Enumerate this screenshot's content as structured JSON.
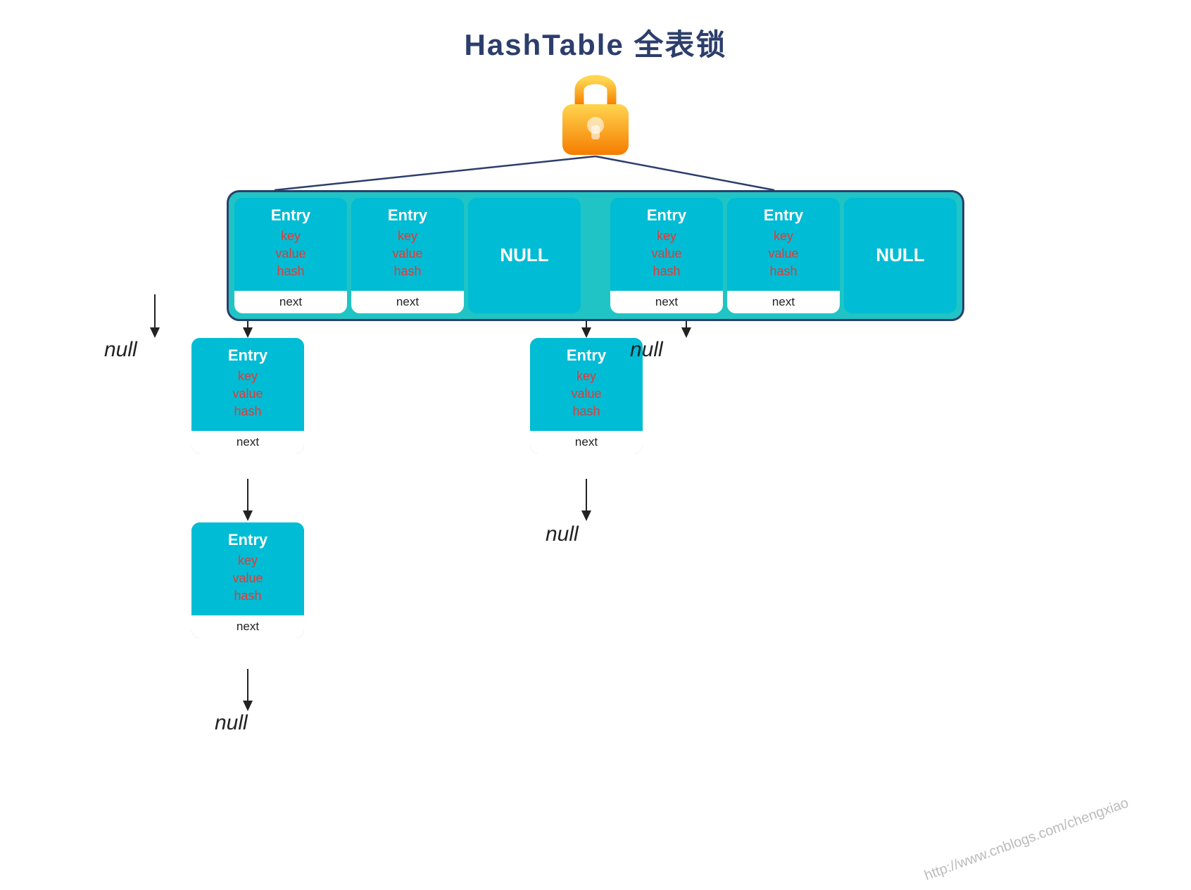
{
  "title": "HashTable 全表锁",
  "watermark": "http://www.cnblogs.com/chengxiao",
  "table_row1": [
    {
      "type": "entry",
      "fields": [
        "key",
        "value",
        "hash"
      ],
      "next": "next"
    },
    {
      "type": "entry",
      "fields": [
        "key",
        "value",
        "hash"
      ],
      "next": "next"
    },
    {
      "type": "null"
    },
    {
      "type": "entry",
      "fields": [
        "key",
        "value",
        "hash"
      ],
      "next": "next"
    },
    {
      "type": "entry",
      "fields": [
        "key",
        "value",
        "hash"
      ],
      "next": "next"
    },
    {
      "type": "null"
    }
  ],
  "null_label": "NULL",
  "entry_label": "Entry",
  "next_label": "next",
  "null_text": "null",
  "key_label": "key",
  "value_label": "value",
  "hash_label": "hash"
}
